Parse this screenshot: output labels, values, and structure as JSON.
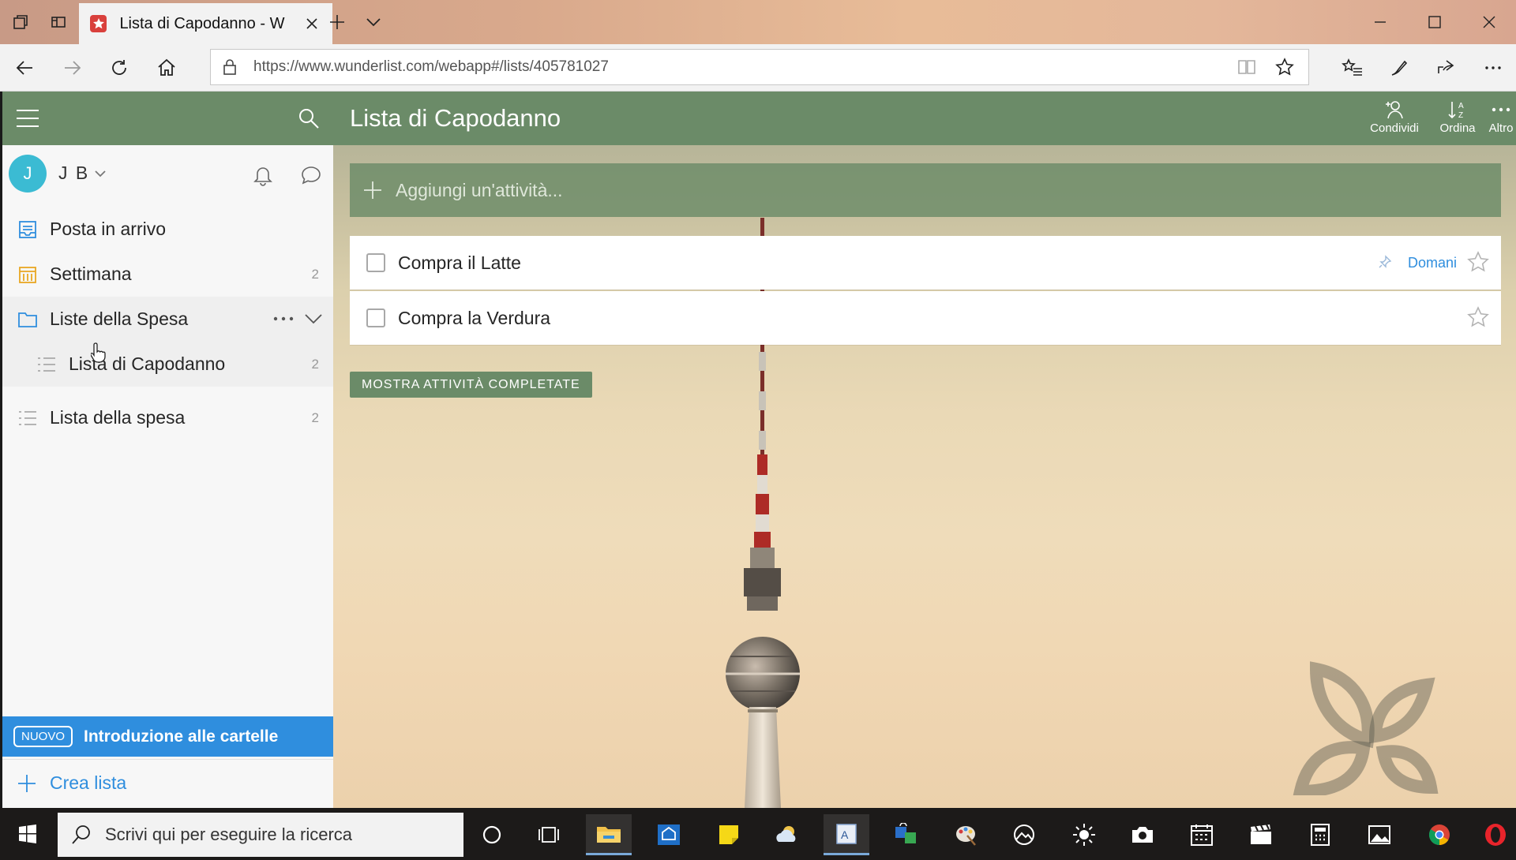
{
  "browser": {
    "tab_title": "Lista di Capodanno - W",
    "url": "https://www.wunderlist.com/webapp#/lists/405781027"
  },
  "sidebar": {
    "user_initial": "J",
    "user_name": "J B",
    "items": [
      {
        "label": "Posta in arrivo",
        "count": ""
      },
      {
        "label": "Settimana",
        "count": "2"
      },
      {
        "label": "Liste della Spesa",
        "count": ""
      },
      {
        "label": "Lista di Capodanno",
        "count": "2"
      },
      {
        "label": "Lista della spesa",
        "count": "2"
      }
    ],
    "tour_badge": "NUOVO",
    "tour_text": "Introduzione alle cartelle",
    "create_list": "Crea lista"
  },
  "main": {
    "title": "Lista di Capodanno",
    "actions": [
      {
        "label": "Condividi"
      },
      {
        "label": "Ordina"
      },
      {
        "label": "Altro"
      }
    ],
    "add_placeholder": "Aggiungi un'attività...",
    "tasks": [
      {
        "title": "Compra il Latte",
        "due": "Domani"
      },
      {
        "title": "Compra la Verdura",
        "due": ""
      }
    ],
    "show_completed": "MOSTRA ATTIVITÀ COMPLETATE"
  },
  "taskbar": {
    "search_placeholder": "Scrivi qui per eseguire la ricerca"
  },
  "colors": {
    "header_green": "#6b8b68",
    "accent_blue": "#2f8ede",
    "avatar": "#3bbbd3"
  }
}
